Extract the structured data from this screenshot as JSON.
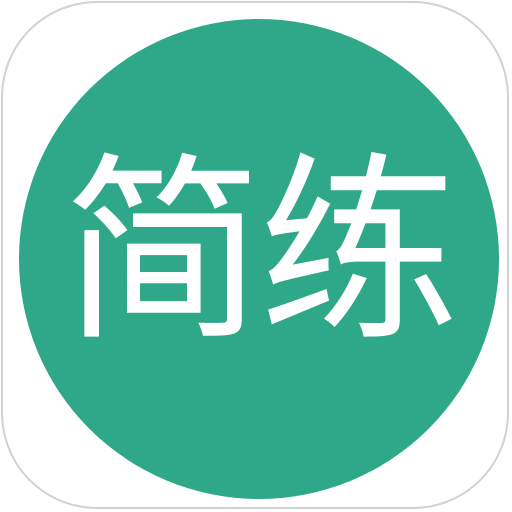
{
  "app_icon": {
    "name": "简练",
    "colors": {
      "badge": "#2ea888",
      "text": "#ffffff",
      "tile_background": "#ffffff",
      "tile_border": "#d2d2d2"
    }
  }
}
